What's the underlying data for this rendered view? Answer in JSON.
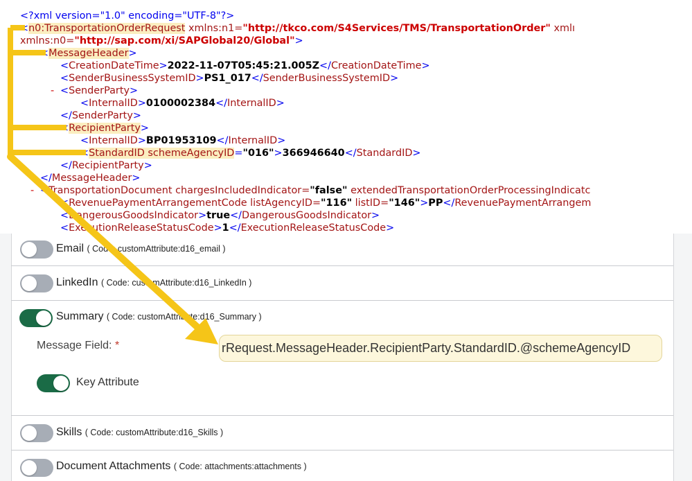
{
  "xml": {
    "declaration": "<?xml version=\"1.0\" encoding=\"UTF-8\"?>",
    "root_tag": "n0:TransportationOrderRequest",
    "root_ns1_attr": " xmlns:n1=",
    "root_ns1_val": "\"http://tkco.com/S4Services/TMS/TransportationOrder\"",
    "root_ns1_tail": " xmlı",
    "root_ns0_attr": "xmlns:n0=",
    "root_ns0_val": "\"http://sap.com/xi/SAPGlobal20/Global\"",
    "message_header": "MessageHeader",
    "creation_datetime_tag": "CreationDateTime",
    "creation_datetime_value": "2022-11-07T05:45:21.005Z",
    "sender_system_tag": "SenderBusinessSystemID",
    "sender_system_value": "PS1_017",
    "dash": "-",
    "sender_party_tag": "SenderParty",
    "internal_id_tag": "InternalID",
    "sender_internal_id": "0100002384",
    "recipient_party_tag": "RecipientParty",
    "recipient_internal_id": "BP01953109",
    "standard_id_open": "StandardID schemeAgencyID",
    "standard_id_tag": "StandardID",
    "scheme_agency_value": "\"016\"",
    "standard_id_value": "366946640",
    "transport_doc_tag": "TransportationDocument",
    "charges_attr": " chargesIncludedIndicator=",
    "charges_val": "\"false\"",
    "extended_attr": " extendedTransportationOrderProcessingIndicatc",
    "revenue_tag": "RevenuePaymentArrangementCode",
    "list_agency_attr": " listAgencyID=",
    "list_agency_val": "\"116\"",
    "list_id_attr": " listID=",
    "list_id_val": "\"146\"",
    "revenue_value": "PP",
    "revenue_close": "RevenuePaymentArrangem",
    "dangerous_tag": "DangerousGoodsIndicator",
    "dangerous_value": "true",
    "execution_tag": "ExecutionReleaseStatusCode",
    "execution_value": "1"
  },
  "attributes": [
    {
      "label": "Email",
      "code": "( Code: customAttribute:d16_email )",
      "enabled": false
    },
    {
      "label": "LinkedIn",
      "code": "( Code: customAttribute:d16_LinkedIn )",
      "enabled": false
    },
    {
      "label": "Summary",
      "code": "( Code: customAttribute:d16_Summary )",
      "enabled": true
    },
    {
      "label": "Skills",
      "code": "( Code: customAttribute:d16_Skills )",
      "enabled": false
    },
    {
      "label": "Document Attachments",
      "code": "( Code: attachments:attachments )",
      "enabled": false
    }
  ],
  "summary_detail": {
    "message_field_label": "Message Field:",
    "required_mark": "*",
    "message_field_value": "rRequest.MessageHeader.RecipientParty.StandardID.@schemeAgencyID",
    "key_attribute_label": "Key Attribute",
    "key_attribute_enabled": true
  },
  "colors": {
    "arrow": "#f5c518",
    "toggle_on": "#1a6b46",
    "toggle_off": "#a7adb6",
    "field_bg": "#fdf7dc"
  }
}
